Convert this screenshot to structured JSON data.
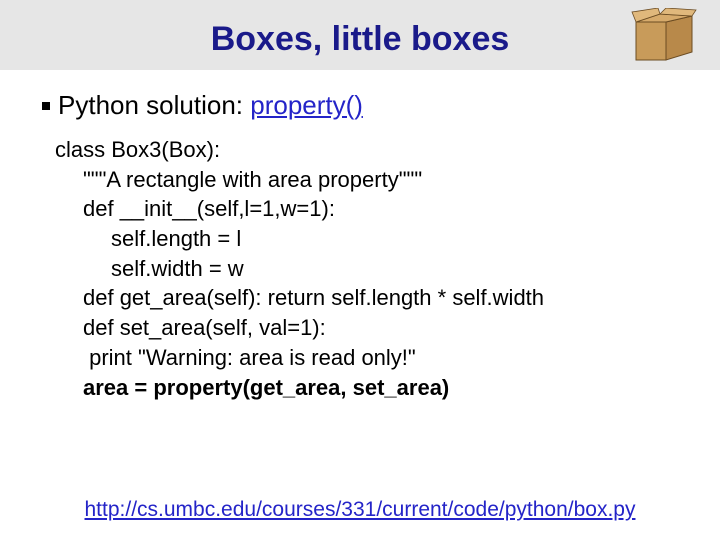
{
  "header": {
    "title": "Boxes, little boxes"
  },
  "bullet": {
    "prefix": "Python solution: ",
    "link": "property()"
  },
  "code": {
    "l0": "class Box3(Box):",
    "l1": "\"\"\"A rectangle with area property\"\"\"",
    "l2": "def __init__(self,l=1,w=1):",
    "l3": "self.length = l",
    "l4": "self.width = w",
    "l5": "def get_area(self): return self.length * self.width",
    "l6": "def set_area(self, val=1):",
    "l7": " print \"Warning: area is read only!\"",
    "l8": "area = property(get_area, set_area)"
  },
  "footer": {
    "url": "http://cs.umbc.edu/courses/331/current/code/python/box.py"
  }
}
